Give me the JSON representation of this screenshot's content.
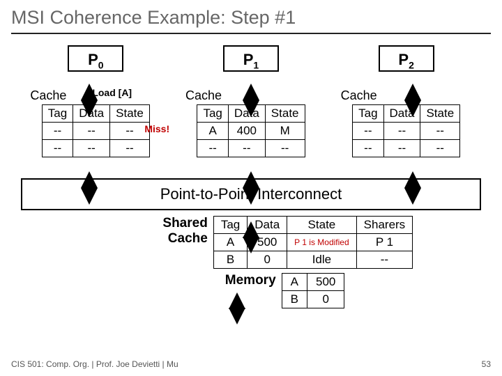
{
  "title": "MSI Coherence Example: Step #1",
  "processors": [
    "P",
    "P",
    "P"
  ],
  "proc_subs": [
    "0",
    "1",
    "2"
  ],
  "load_label": "Load [A]",
  "miss_label": "Miss!",
  "cache_label": "Cache",
  "cache_headers": [
    "Tag",
    "Data",
    "State"
  ],
  "caches": [
    {
      "rows": [
        [
          "--",
          "--",
          "--"
        ],
        [
          "--",
          "--",
          "--"
        ]
      ]
    },
    {
      "rows": [
        [
          "A",
          "400",
          "M"
        ],
        [
          "--",
          "--",
          "--"
        ]
      ]
    },
    {
      "rows": [
        [
          "--",
          "--",
          "--"
        ],
        [
          "--",
          "--",
          "--"
        ]
      ]
    }
  ],
  "interconnect": "Point-to-Point Interconnect",
  "shared_label_l1": "Shared",
  "shared_label_l2": "Cache",
  "shared_headers": [
    "Tag",
    "Data",
    "State",
    "Sharers"
  ],
  "shared_rows": [
    [
      "A",
      "500",
      "P 1 is Modified",
      "P 1"
    ],
    [
      "B",
      "0",
      "Idle",
      "--"
    ]
  ],
  "memory_label": "Memory",
  "memory_rows": [
    [
      "A",
      "500"
    ],
    [
      "B",
      "0"
    ]
  ],
  "footer_left": "CIS 501: Comp. Org. | Prof. Joe Devietti | Mu",
  "footer_right": "53"
}
